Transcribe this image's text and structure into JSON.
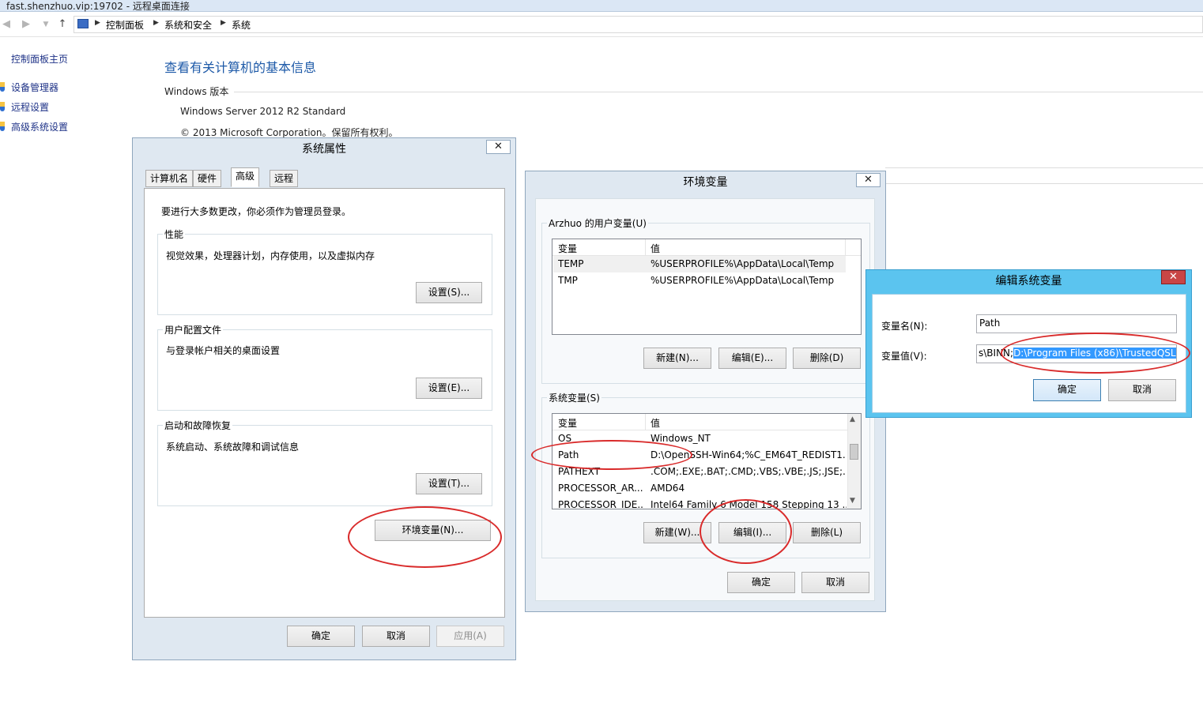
{
  "window": {
    "title": "fast.shenzhuo.vip:19702 - 远程桌面连接"
  },
  "nav": {
    "breadcrumb": [
      "控制面板",
      "系统和安全",
      "系统"
    ]
  },
  "sidebar": {
    "home": "控制面板主页",
    "items": [
      {
        "label": "设备管理器",
        "icon": "shield-icon"
      },
      {
        "label": "远程设置",
        "icon": "shield-icon"
      },
      {
        "label": "高级系统设置",
        "icon": "shield-icon"
      }
    ]
  },
  "main": {
    "title": "查看有关计算机的基本信息",
    "windows_section": "Windows 版本",
    "edition": "Windows Server 2012 R2 Standard",
    "copyright": "© 2013 Microsoft Corporation。保留所有权利。"
  },
  "sysprops": {
    "title": "系统属性",
    "tabs": [
      "计算机名",
      "硬件",
      "高级",
      "远程"
    ],
    "admin_note": "要进行大多数更改，你必须作为管理员登录。",
    "perf": {
      "label": "性能",
      "desc": "视觉效果，处理器计划，内存使用，以及虚拟内存",
      "button": "设置(S)..."
    },
    "profile": {
      "label": "用户配置文件",
      "desc": "与登录帐户相关的桌面设置",
      "button": "设置(E)..."
    },
    "startup": {
      "label": "启动和故障恢复",
      "desc": "系统启动、系统故障和调试信息",
      "button": "设置(T)..."
    },
    "env_button": "环境变量(N)...",
    "ok": "确定",
    "cancel": "取消",
    "apply": "应用(A)"
  },
  "envvars": {
    "title": "环境变量",
    "user_label": "Arzhuo 的用户变量(U)",
    "col_var": "变量",
    "col_val": "值",
    "user_rows": [
      {
        "name": "TEMP",
        "value": "%USERPROFILE%\\AppData\\Local\\Temp"
      },
      {
        "name": "TMP",
        "value": "%USERPROFILE%\\AppData\\Local\\Temp"
      }
    ],
    "user_new": "新建(N)...",
    "user_edit": "编辑(E)...",
    "user_delete": "删除(D)",
    "sys_label": "系统变量(S)",
    "sys_rows": [
      {
        "name": "OS",
        "value": "Windows_NT"
      },
      {
        "name": "Path",
        "value": "D:\\OpenSSH-Win64;%C_EM64T_REDIST1..."
      },
      {
        "name": "PATHEXT",
        "value": ".COM;.EXE;.BAT;.CMD;.VBS;.VBE;.JS;.JSE;...."
      },
      {
        "name": "PROCESSOR_AR...",
        "value": "AMD64"
      },
      {
        "name": "PROCESSOR_IDE...",
        "value": "Intel64 Family 6 Model 158 Stepping 13 ..."
      }
    ],
    "sys_new": "新建(W)...",
    "sys_edit": "编辑(I)...",
    "sys_delete": "删除(L)",
    "ok": "确定",
    "cancel": "取消"
  },
  "editvar": {
    "title": "编辑系统变量",
    "name_label": "变量名(N):",
    "name_value": "Path",
    "value_label": "变量值(V):",
    "value_prefix": "s\\BINN;",
    "value_selected": "D:\\Program Files (x86)\\TrustedQSL",
    "ok": "确定",
    "cancel": "取消"
  },
  "colors": {
    "link": "#1e3287",
    "title_blue": "#1e5aa8",
    "annotation_red": "#d92b2b",
    "selection": "#3399ff"
  }
}
